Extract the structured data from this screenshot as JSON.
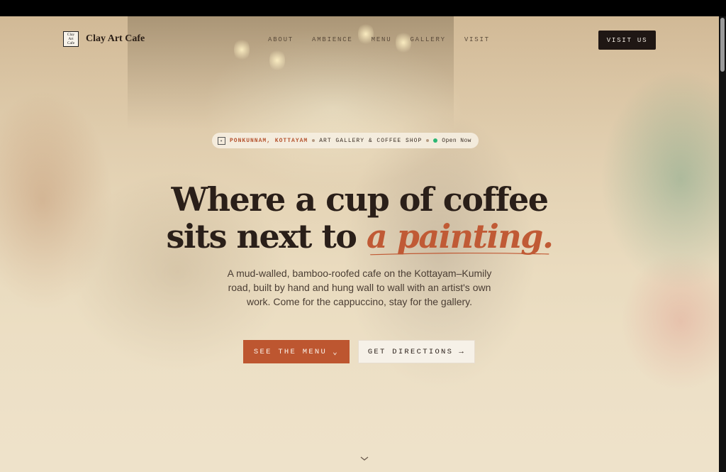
{
  "brand": {
    "logo_text": "Clay Art Cafe",
    "name": "Clay Art Cafe"
  },
  "nav": {
    "links": [
      "ABOUT",
      "AMBIENCE",
      "MENU",
      "GALLERY",
      "VISIT"
    ],
    "cta": "VISIT US"
  },
  "badge": {
    "location": "PONKUNNAM, KOTTAYAM",
    "descriptor": "ART GALLERY & COFFEE SHOP",
    "status": "Open Now"
  },
  "hero": {
    "line1": "Where a cup of coffee",
    "line2_lead": "sits next to",
    "line2_accent": "a painting.",
    "subtitle": "A mud-walled, bamboo-roofed cafe on the Kottayam–Kumily road, built by hand and hung wall to wall with an artist's own work. Come for the cappuccino, stay for the gallery."
  },
  "actions": {
    "primary": "SEE THE MENU",
    "secondary": "GET DIRECTIONS"
  },
  "colors": {
    "accent": "#bd5630",
    "dark": "#1f1714",
    "status_green": "#2bb673"
  },
  "icons": {
    "primary_button": "chevron-down-icon",
    "secondary_button": "arrow-right-icon",
    "scroll_hint": "chevron-down-icon"
  }
}
